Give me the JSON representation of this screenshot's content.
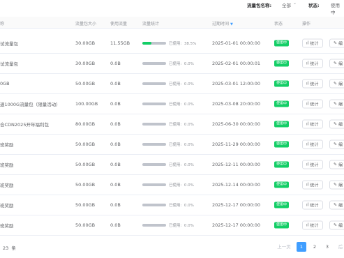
{
  "filters": {
    "pkg_name_label": "流量包名称:",
    "pkg_name_value": "全部",
    "status_label": "状态:",
    "status_value": "使用中"
  },
  "columns": {
    "name": "称",
    "size": "流量包大小",
    "used": "使用流量",
    "stats": "流量统计",
    "expire": "过期时间",
    "status": "状态",
    "actions": "操作"
  },
  "used_prefix": "已使用:",
  "stat_button": "统计",
  "edit_button": "编",
  "rows": [
    {
      "name": "试流量包",
      "size": "30.00GB",
      "used": "11.55GB",
      "percent": "38.5%",
      "fill": 0.385,
      "expire": "2025-01-01 00:00:00",
      "status": "使用中"
    },
    {
      "name": "试流量包",
      "size": "30.00GB",
      "used": "0.0B",
      "percent": "0.0%",
      "fill": 0,
      "expire": "2025-02-01 00:00:01",
      "status": "使用中"
    },
    {
      "name": "0GB",
      "size": "50.00GB",
      "used": "0.0B",
      "percent": "0.0%",
      "fill": 0,
      "expire": "2025-03-01 12:00:00",
      "status": "使用中"
    },
    {
      "name": "速1000G流量包（限量活动）",
      "size": "100.00GB",
      "used": "0.0B",
      "percent": "0.0%",
      "fill": 0,
      "expire": "2025-03-08 20:00:00",
      "status": "使用中"
    },
    {
      "name": "合CDN2025开年福利包",
      "size": "80.00GB",
      "used": "0.0B",
      "percent": "0.0%",
      "fill": 0,
      "expire": "2025-06-30 00:00:00",
      "status": "使用中"
    },
    {
      "name": "班奖励",
      "size": "50.00GB",
      "used": "0.0B",
      "percent": "0.0%",
      "fill": 0,
      "expire": "2025-11-29 00:00:00",
      "status": "使用中"
    },
    {
      "name": "班奖励",
      "size": "50.00GB",
      "used": "0.0B",
      "percent": "0.0%",
      "fill": 0,
      "expire": "2025-12-11 00:00:00",
      "status": "使用中"
    },
    {
      "name": "班奖励",
      "size": "50.00GB",
      "used": "0.0B",
      "percent": "0.0%",
      "fill": 0,
      "expire": "2025-12-14 00:00:00",
      "status": "使用中"
    },
    {
      "name": "班奖励",
      "size": "50.00GB",
      "used": "0.0B",
      "percent": "0.0%",
      "fill": 0,
      "expire": "2025-12-17 00:00:00",
      "status": "使用中"
    },
    {
      "name": "班奖励",
      "size": "50.00GB",
      "used": "0.0B",
      "percent": "0.0%",
      "fill": 0,
      "expire": "2025-12-17 00:00:00",
      "status": "使用中"
    }
  ],
  "pagination": {
    "total_count": "23",
    "total_unit": "条",
    "prev": "上一页",
    "pages": [
      "1",
      "2",
      "3"
    ],
    "active_page": "1",
    "next": "后"
  },
  "colors": {
    "accent": "#409eff",
    "status_green": "#13ce66",
    "bar_track": "#c0c4cc"
  }
}
